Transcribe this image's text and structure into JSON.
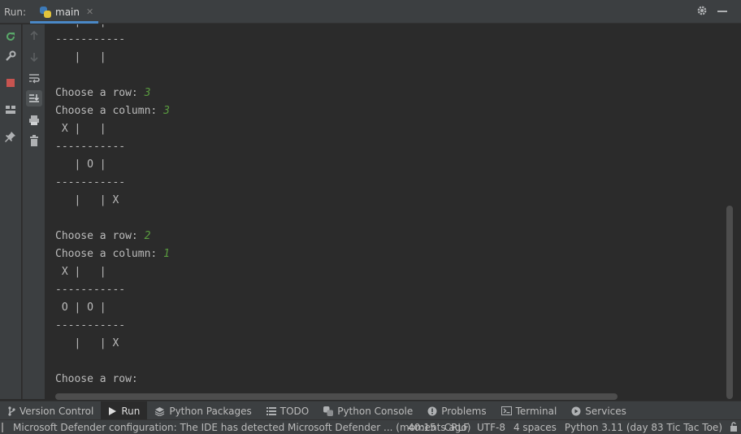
{
  "header": {
    "run_label": "Run:",
    "tab_label": "main"
  },
  "console": {
    "lines": [
      {
        "text": "   | O |",
        "input": ""
      },
      {
        "text": "-----------",
        "input": ""
      },
      {
        "text": "   |   |",
        "input": ""
      },
      {
        "text": "",
        "input": ""
      },
      {
        "text": "Choose a row: ",
        "input": "3"
      },
      {
        "text": "Choose a column: ",
        "input": "3"
      },
      {
        "text": " X |   |",
        "input": ""
      },
      {
        "text": "-----------",
        "input": ""
      },
      {
        "text": "   | O |",
        "input": ""
      },
      {
        "text": "-----------",
        "input": ""
      },
      {
        "text": "   |   | X",
        "input": ""
      },
      {
        "text": "",
        "input": ""
      },
      {
        "text": "Choose a row: ",
        "input": "2"
      },
      {
        "text": "Choose a column: ",
        "input": "1"
      },
      {
        "text": " X |   |",
        "input": ""
      },
      {
        "text": "-----------",
        "input": ""
      },
      {
        "text": " O | O |",
        "input": ""
      },
      {
        "text": "-----------",
        "input": ""
      },
      {
        "text": "   |   | X",
        "input": ""
      },
      {
        "text": "",
        "input": ""
      },
      {
        "text": "Choose a row: ",
        "input": ""
      }
    ]
  },
  "toolwindows": [
    {
      "label": "Version Control",
      "icon": "branch-icon",
      "active": false
    },
    {
      "label": "Run",
      "icon": "run-icon",
      "active": true
    },
    {
      "label": "Python Packages",
      "icon": "packages-icon",
      "active": false
    },
    {
      "label": "TODO",
      "icon": "list-icon",
      "active": false
    },
    {
      "label": "Python Console",
      "icon": "python-icon",
      "active": false
    },
    {
      "label": "Problems",
      "icon": "problems-icon",
      "active": false
    },
    {
      "label": "Terminal",
      "icon": "terminal-icon",
      "active": false
    },
    {
      "label": "Services",
      "icon": "services-icon",
      "active": false
    }
  ],
  "statusbar": {
    "message": "Microsoft Defender configuration: The IDE has detected Microsoft Defender ... (moments ago)",
    "position": "40:15",
    "line_separator": "CRLF",
    "encoding": "UTF-8",
    "indent": "4 spaces",
    "interpreter": "Python 3.11 (day 83 Tic Tac Toe)"
  },
  "colors": {
    "accent": "#4a88c7",
    "input_text": "#5a9c3f",
    "stop": "#c75450",
    "rerun": "#59a869"
  }
}
